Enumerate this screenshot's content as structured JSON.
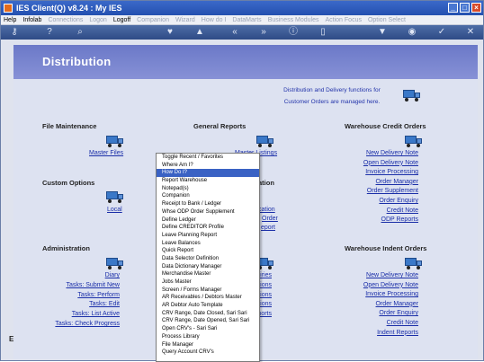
{
  "window": {
    "title": "IES Client(Q) v8.24 : My IES"
  },
  "menubar": {
    "items": [
      {
        "label": "Help",
        "enabled": true
      },
      {
        "label": "Infolab",
        "enabled": true
      },
      {
        "label": "Connections",
        "enabled": false
      },
      {
        "label": "Logon",
        "enabled": false
      },
      {
        "label": "Logoff",
        "enabled": true
      },
      {
        "label": "Companion",
        "enabled": false
      },
      {
        "label": "Wizard",
        "enabled": false
      },
      {
        "label": "How do I",
        "enabled": false
      },
      {
        "label": "DataMarts",
        "enabled": false
      },
      {
        "label": "Business Modules",
        "enabled": false
      },
      {
        "label": "Action Focus",
        "enabled": false
      },
      {
        "label": "Option Select",
        "enabled": false
      }
    ]
  },
  "page": {
    "title": "Distribution",
    "info_line1": "Distribution and Delivery functions for",
    "info_line2": "Customer Orders are managed here."
  },
  "sections": {
    "file_maintenance": {
      "heading": "File Maintenance",
      "links": [
        "Master Files"
      ]
    },
    "general_reports": {
      "heading": "General Reports",
      "links": [
        "Master Listings"
      ]
    },
    "warehouse_credit": {
      "heading": "Warehouse Credit Orders",
      "links": [
        "New Delivery Note",
        "Open Delivery Note",
        "Invoice Processing",
        "Order Manager",
        "Order Supplement",
        "Order Enquiry",
        "Credit Note",
        "ODP Reports"
      ]
    },
    "custom_options": {
      "heading": "Custom Options",
      "links": [
        "Local"
      ]
    },
    "middle_mid": {
      "heading": "ation",
      "links": [
        "cation",
        "Order",
        "eport"
      ]
    },
    "administration": {
      "heading": "Administration",
      "links": [
        "Diary",
        "Tasks: Submit New",
        "Tasks: Perform",
        "Tasks: Edit",
        "Tasks: List Active",
        "Tasks: Check Progress"
      ]
    },
    "middle_low": {
      "links": [
        "uiries",
        "ctions",
        "ctions",
        "ctions",
        "ports"
      ]
    },
    "warehouse_indent": {
      "heading": "Warehouse Indent Orders",
      "links": [
        "New Delivery Note",
        "Open Delivery Note",
        "Invoice Processing",
        "Order Manager",
        "Order Enquiry",
        "Credit Note",
        "Indent Reports"
      ]
    }
  },
  "context_menu": {
    "selected_index": 2,
    "items": [
      "Toggle Recent / Favorites",
      "Where Am I?",
      "How Do I?",
      "Report Warehouse",
      "Notepad(s)",
      "Companion",
      "Receipt to Bank / Ledger",
      "Whse ODP Order Supplement",
      "Define Ledger",
      "Define CREDITOR Profile",
      "Leave Planning Report",
      "Leave Balances",
      "Quick Report",
      "Data Selector Definition",
      "Data Dictionary Manager",
      "Merchandise Master",
      "Jobs Master",
      "Screen / Forms Manager",
      "AR Receivables / Debtors Master",
      "AR Debtor Auto Template",
      "CRV Range, Date Closed, Sari Sari",
      "CRV Range, Date Opened, Sari Sari",
      "Open CRV's - Sari Sari",
      "Process Library",
      "File Manager",
      "Query Account CRV's"
    ]
  },
  "left_stub": "E",
  "colors": {
    "accent": "#3a62c4",
    "link": "#1a2ea8",
    "banner": "#7a86d0"
  }
}
